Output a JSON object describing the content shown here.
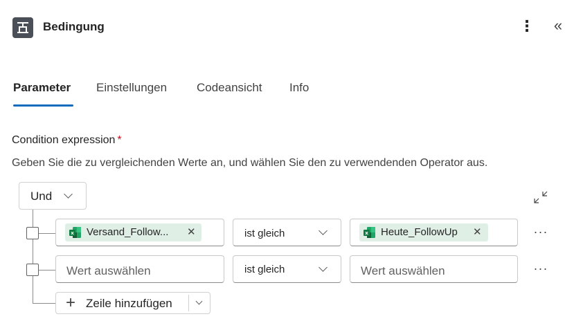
{
  "header": {
    "icon": "condition-icon",
    "title": "Bedingung",
    "more_icon": "more-vertical-icon",
    "collapse_icon": "double-chevron-left-icon"
  },
  "tabs": [
    {
      "label": "Parameter",
      "active": true
    },
    {
      "label": "Einstellungen",
      "active": false
    },
    {
      "label": "Codeansicht",
      "active": false
    },
    {
      "label": "Info",
      "active": false
    }
  ],
  "condition": {
    "label": "Condition expression",
    "required_mark": "*",
    "description": "Geben Sie die zu vergleichenden Werte an, und wählen Sie den zu verwendenden Operator aus.",
    "group_operator": "Und",
    "rows": [
      {
        "left_token": "Versand_Follow...",
        "operator": "ist gleich",
        "right_token": "Heute_FollowUp"
      },
      {
        "left_placeholder": "Wert auswählen",
        "operator": "ist gleich",
        "right_placeholder": "Wert auswählen"
      }
    ],
    "row_more": "···",
    "token_remove": "✕",
    "add_row_label": "Zeile hinzufügen"
  },
  "colors": {
    "accent": "#0f6cbd",
    "required": "#c50f1f",
    "token_bg": "#e0efe6",
    "excel_green": "#107c41"
  }
}
